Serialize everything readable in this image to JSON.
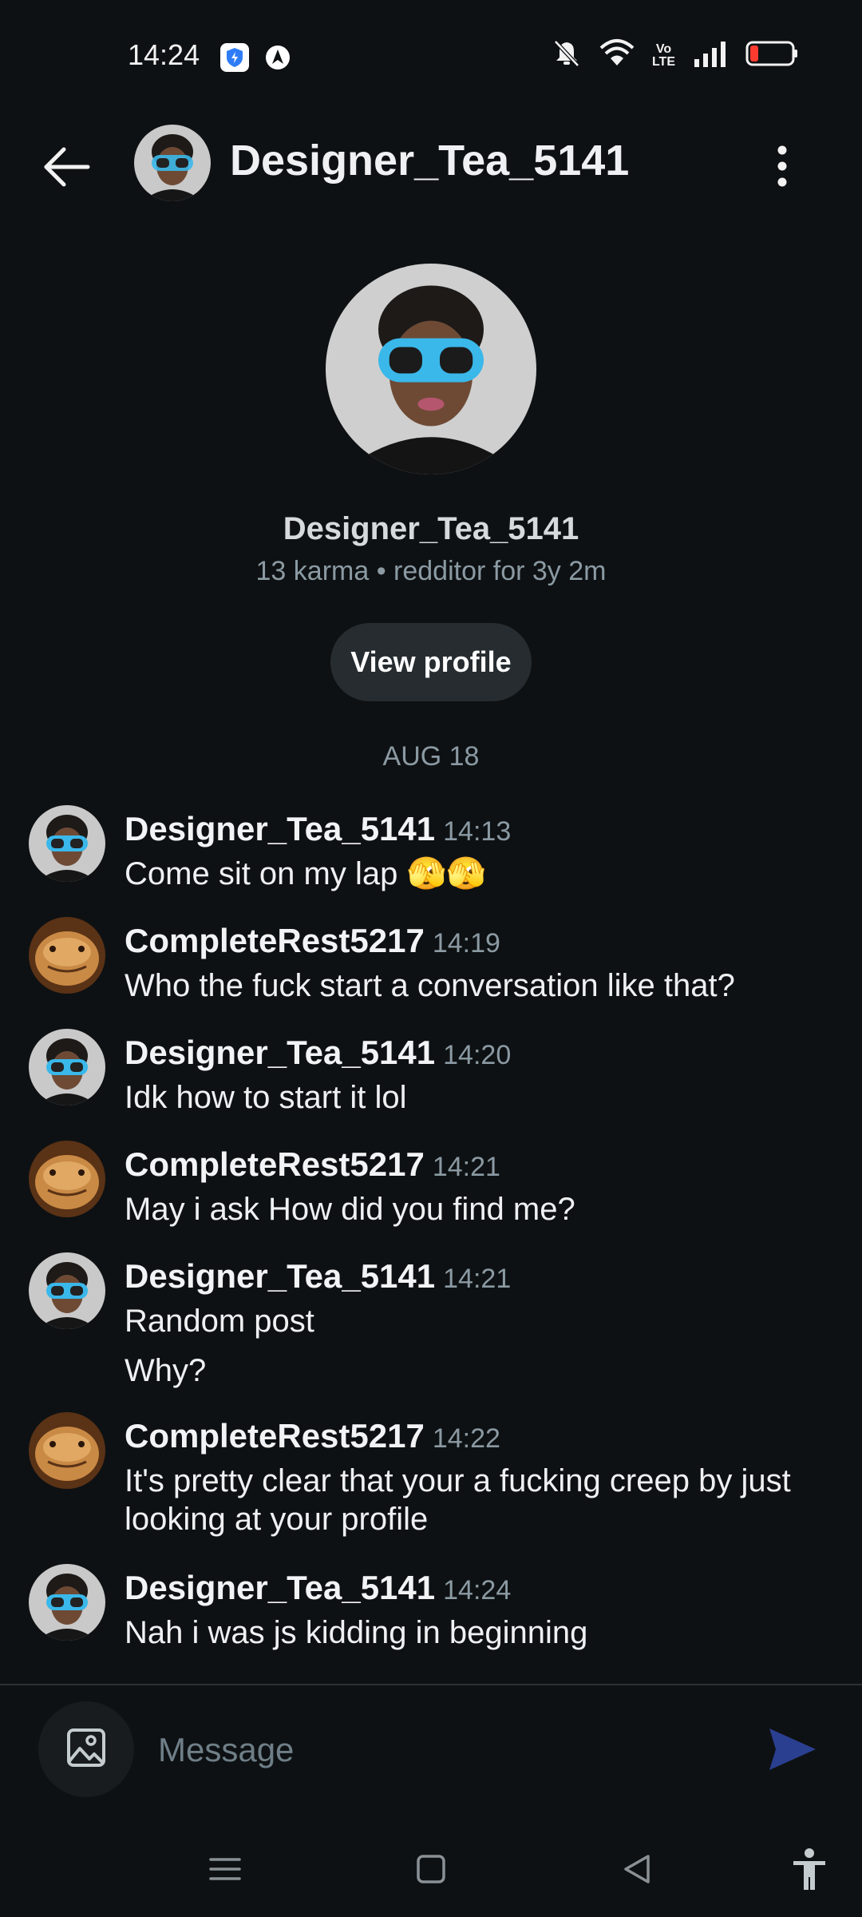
{
  "status_bar": {
    "time": "14:24",
    "icons": [
      "shield-app-icon",
      "navigation-app-icon",
      "mute-icon",
      "wifi-icon",
      "volte-icon",
      "signal-icon",
      "battery-low-icon"
    ]
  },
  "header": {
    "title": "Designer_Tea_5141",
    "back_icon": "arrow-left-icon",
    "more_icon": "more-vertical-icon"
  },
  "profile": {
    "name": "Designer_Tea_5141",
    "meta": "13 karma • redditor for 3y 2m",
    "view_profile_label": "View profile"
  },
  "date_separator": "AUG 18",
  "messages": [
    {
      "author": "Designer_Tea_5141",
      "time": "14:13",
      "lines": [
        "Come sit on my lap 🫣🫣"
      ]
    },
    {
      "author": "CompleteRest5217",
      "time": "14:19",
      "lines": [
        "Who the fuck start a conversation like that?"
      ]
    },
    {
      "author": "Designer_Tea_5141",
      "time": "14:20",
      "lines": [
        "Idk how to start it lol"
      ]
    },
    {
      "author": "CompleteRest5217",
      "time": "14:21",
      "lines": [
        "May i ask How did you find me?"
      ]
    },
    {
      "author": "Designer_Tea_5141",
      "time": "14:21",
      "lines": [
        "Random post",
        "Why?"
      ]
    },
    {
      "author": "CompleteRest5217",
      "time": "14:22",
      "lines": [
        "It's pretty clear that your a fucking creep by just looking at your profile"
      ]
    },
    {
      "author": "Designer_Tea_5141",
      "time": "14:24",
      "lines": [
        "Nah i was js kidding in beginning"
      ]
    }
  ],
  "composer": {
    "placeholder": "Message",
    "attach_icon": "image-icon",
    "send_icon": "send-icon",
    "accent_color": "#2a3f8f"
  },
  "nav_bar": {
    "icons": [
      "menu-icon",
      "home-square-icon",
      "back-triangle-icon",
      "accessibility-icon"
    ]
  },
  "colors": {
    "background": "#0e1113",
    "muted_text": "#8b9aa3",
    "button_bg": "#262c30"
  }
}
